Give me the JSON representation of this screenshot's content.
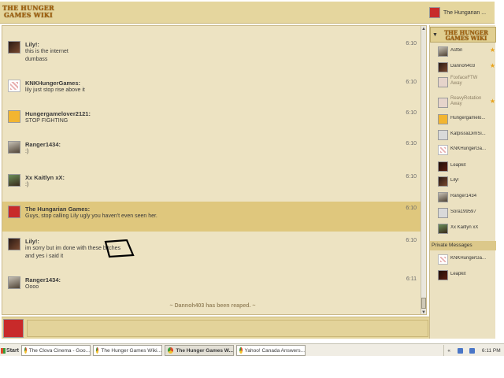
{
  "header": {
    "logo_text": "THE HUNGER GAMES WIKI",
    "user_name": "The Hungarian ..."
  },
  "messages": [
    {
      "name": "Lily!:",
      "lines": [
        "this is the internet",
        "dumbass"
      ],
      "time": "6:10",
      "avatar": "dark"
    },
    {
      "name": "KNKHungerGames:",
      "lines": [
        "lily just stop rise above it"
      ],
      "time": "6:10",
      "avatar": "knk"
    },
    {
      "name": "Hungergamelover2121:",
      "lines": [
        "STOP FIGHTING"
      ],
      "time": "6:10",
      "avatar": "sun"
    },
    {
      "name": "Ranger1434:",
      "lines": [
        ":)"
      ],
      "time": "6:10",
      "avatar": "photo"
    },
    {
      "name": "Xx Kaitlyn xX:",
      "lines": [
        ":)"
      ],
      "time": "6:10",
      "avatar": "green"
    },
    {
      "name": "The Hungarian Games:",
      "lines": [
        "Guys, stop calling Lily ugly you haven't even seen her."
      ],
      "time": "6:10",
      "avatar": "red"
    },
    {
      "name": "Lily!:",
      "lines": [
        "im sorry but im done with these bitches",
        "and yes i said it"
      ],
      "time": "6:10",
      "avatar": "dark"
    },
    {
      "name": "Ranger1434:",
      "lines": [
        "Oooo"
      ],
      "time": "6:11",
      "avatar": "photo"
    }
  ],
  "system_message": "~ Dannoh403 has been reaped. ~",
  "sidebar": {
    "wiki_logo_text": "THE HUNGER GAMES WIKI",
    "users": [
      {
        "name": "Asfbn",
        "avatar": "photo",
        "star": true
      },
      {
        "name": "Dannoh403",
        "avatar": "dark",
        "star": true
      },
      {
        "name": "FoxfaceFTW",
        "status": "Away",
        "avatar": "faded",
        "star": false
      },
      {
        "name": "ReavyRotation",
        "status": "Away",
        "avatar": "faded",
        "star": true
      },
      {
        "name": "Hungergamelo...",
        "avatar": "sun",
        "star": false
      },
      {
        "name": "Katpiss&DimSi...",
        "avatar": "grey",
        "star": false
      },
      {
        "name": "KNKHungerGa...",
        "avatar": "knk",
        "star": false
      },
      {
        "name": "Leapkit",
        "avatar": "leap",
        "star": false
      },
      {
        "name": "Lily!",
        "avatar": "dark",
        "star": false
      },
      {
        "name": "Ranger1434",
        "avatar": "photo",
        "star": false
      },
      {
        "name": "Sora199597",
        "avatar": "grey",
        "star": false
      },
      {
        "name": "Xx Kaitlyn xX",
        "avatar": "green",
        "star": false
      }
    ],
    "private_header": "Private Messages",
    "private_users": [
      {
        "name": "KNKHungerGa...",
        "avatar": "knk"
      },
      {
        "name": "Leapkit",
        "avatar": "leap"
      }
    ]
  },
  "taskbar": {
    "start_label": "Start",
    "tasks": [
      {
        "label": "The Clova Cinema - Goo...",
        "icon": "chrome-icon",
        "active": false
      },
      {
        "label": "The Hunger Games Wiki...",
        "icon": "chrome-icon",
        "active": false
      },
      {
        "label": "The Hunger Games W...",
        "icon": "chrome-icon",
        "active": true
      },
      {
        "label": "Yahoo! Canada Answers...",
        "icon": "chrome-icon",
        "active": false
      }
    ],
    "clock": "6:11 PM"
  },
  "colors": {
    "panel_bg": "#ede3c2",
    "header_bg": "#e5d69e",
    "highlight_bg": "#dfc77d"
  }
}
